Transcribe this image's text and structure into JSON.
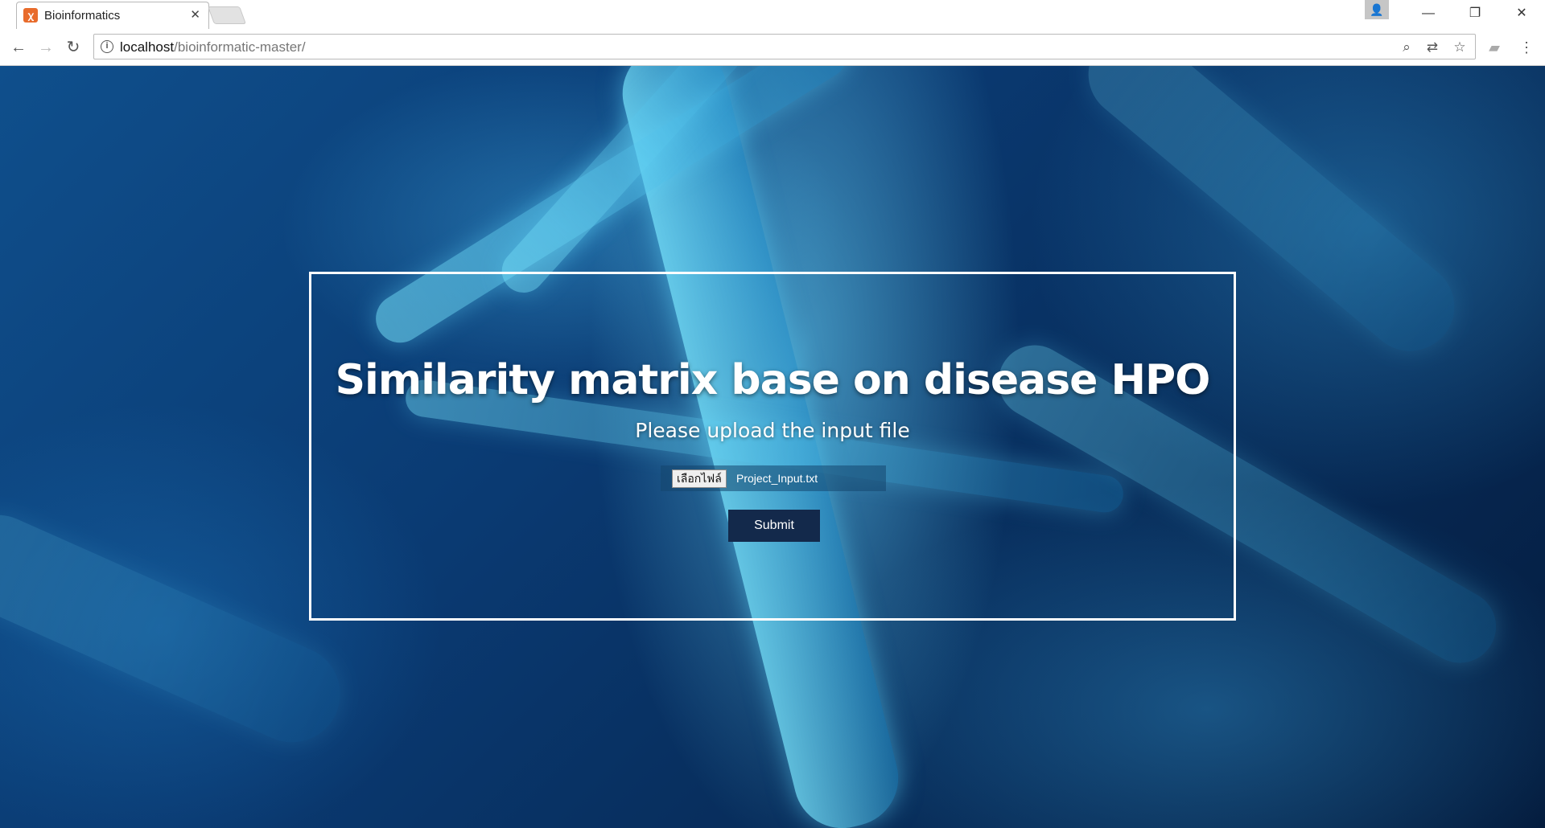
{
  "browser": {
    "tab_title": "Bioinformatics",
    "tab_favicon": "xampp-icon",
    "url_host": "localhost",
    "url_path": "/bioinformatic-master/"
  },
  "page": {
    "title": "Similarity matrix base on disease HPO",
    "subtitle": "Please upload the input file",
    "file_button_label": "เลือกไฟล์",
    "file_name": "Project_Input.txt",
    "submit_label": "Submit"
  },
  "colors": {
    "submit_bg": "#13294b",
    "frame_border": "#ffffff"
  }
}
